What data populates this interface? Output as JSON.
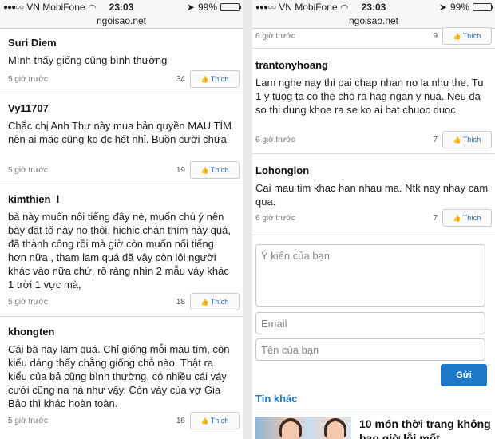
{
  "status_bar": {
    "carrier": "VN MobiFone",
    "time": "23:03",
    "battery_percent": "99%",
    "battery_level": 0.99
  },
  "site": "ngoisao.net",
  "like_label": "Thích",
  "left_comments": [
    {
      "author": "Suri Diem",
      "text": "Mình thấy giống cũng bình thường",
      "ago": "5 giờ trước",
      "likes": "34"
    },
    {
      "author": "Vy11707",
      "text": "Chắc chị Anh Thư này mua bản quyền MÀU TÍM nên ai mặc cũng ko đc hết nhỉ. Buồn cười chưa",
      "ago": "5 giờ trước",
      "likes": "19"
    },
    {
      "author": "kimthien_l",
      "text": "bà này muốn nổi tiếng đây nè, muốn chú ý nên bày đặt tố này nọ thôi, hichic chán thím này quá, đã thành công rồi mà giờ còn muốn nổi tiếng hơn nữa , tham lam quá đã vậy còn lôi người khác vào nữa chứ, rõ ràng nhìn 2 mẫu váy khác 1 trời 1 vực mà,",
      "ago": "5 giờ trước",
      "likes": "18"
    },
    {
      "author": "khongten",
      "text": "Cái bà này làm quá. Chỉ giống mỗi màu tím, còn kiểu dáng thấy chẳng giống chỗ nào. Thật ra kiểu của bả cũng bình thường, có nhiều cái váy cưới cũng na ná như vậy. Còn váy của vợ Gia Bảo thì khác hoàn toàn.",
      "ago": "5 giờ trước",
      "likes": "16"
    }
  ],
  "right_top_meta": {
    "ago": "6 giờ trước",
    "likes": "9"
  },
  "right_comments": [
    {
      "author": "trantonyhoang",
      "text": "Lam nghe nay thi pai chap nhan no la nhu the. Tu 1 y tuog ta co the cho ra hag ngan y nua. Neu da so thi dung khoe ra se ko ai bat chuoc duoc",
      "ago": "6 giờ trước",
      "likes": "7"
    },
    {
      "author": "Lohonglon",
      "text": "Cai mau tim khac han nhau ma. Ntk nay nhay cam qua.",
      "ago": "6 giờ trước",
      "likes": "7"
    }
  ],
  "form": {
    "comment_placeholder": "Ý kiến của bạn",
    "email_placeholder": "Email",
    "name_placeholder": "Tên của bạn",
    "send_label": "Gửi"
  },
  "more_news": {
    "section_title": "Tin khác",
    "headline": "10 món thời trang không bao giờ lỗi mốt"
  }
}
